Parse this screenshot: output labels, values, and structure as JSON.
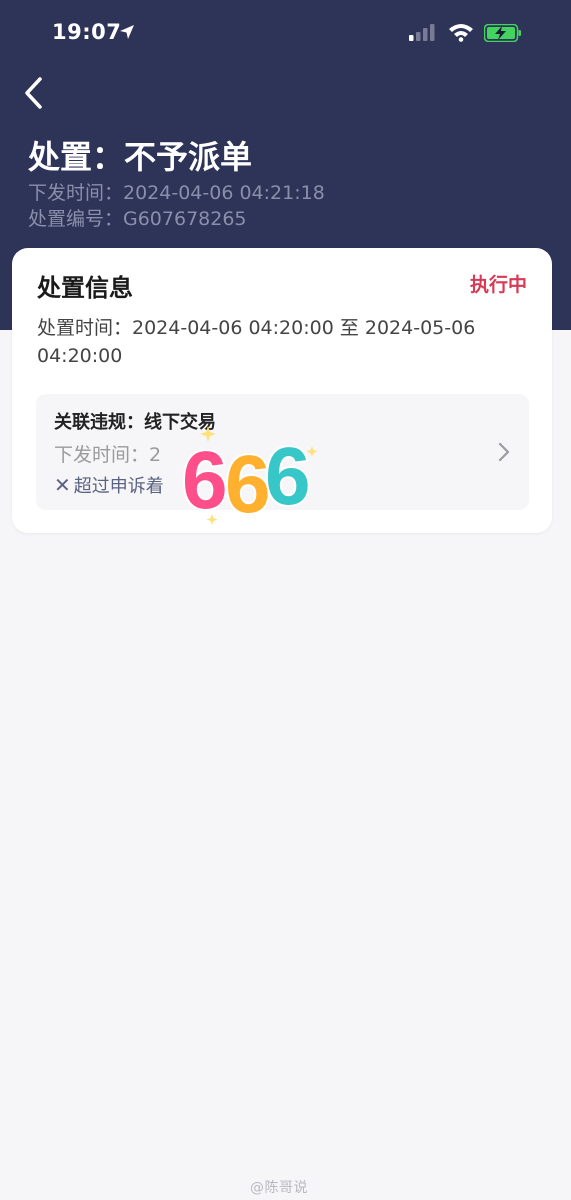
{
  "status_bar": {
    "time": "19:07"
  },
  "header": {
    "title": "处置：不予派单",
    "issue_time": "下发时间：2024-04-06 04:21:18",
    "disposal_no": "处置编号：G607678265"
  },
  "card": {
    "title": "处置信息",
    "status": "执行中",
    "period": "处置时间：2024-04-06 04:20:00 至 2024-05-06 04:20:00",
    "related": {
      "title": "关联违规：线下交易",
      "time": "下发时间：2",
      "status": "超过申诉着"
    }
  },
  "sticker": {
    "text": "666",
    "colors": [
      "#ff4f8b",
      "#ffb02e",
      "#37c7c9"
    ]
  },
  "watermark": "@陈哥说",
  "colors": {
    "header_bg": "#2e3358",
    "status_accent": "#d63a54",
    "battery": "#43d35f"
  }
}
